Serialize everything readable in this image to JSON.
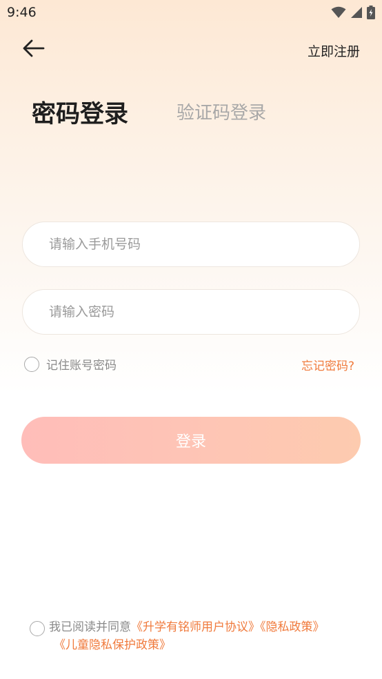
{
  "status_bar": {
    "time": "9:46",
    "icons": [
      "wifi-icon",
      "signal-icon",
      "battery-icon"
    ]
  },
  "header": {
    "back_icon": "arrow-left-icon",
    "register_label": "立即注册"
  },
  "tabs": [
    {
      "label": "密码登录",
      "active": true
    },
    {
      "label": "验证码登录",
      "active": false
    }
  ],
  "form": {
    "phone_placeholder": "请输入手机号码",
    "phone_value": "",
    "password_placeholder": "请输入密码",
    "password_value": "",
    "remember_label": "记住账号密码",
    "remember_checked": false,
    "forgot_label": "忘记密码?",
    "login_label": "登录"
  },
  "agreement": {
    "checked": false,
    "prefix": "我已阅读并同意",
    "links": [
      "《升学有铭师用户协议》",
      "《隐私政策》",
      "《儿童隐私保护政策》"
    ]
  },
  "colors": {
    "accent": "#f07a3c",
    "button_start": "#ffbdb9",
    "button_end": "#fdcbaf"
  }
}
